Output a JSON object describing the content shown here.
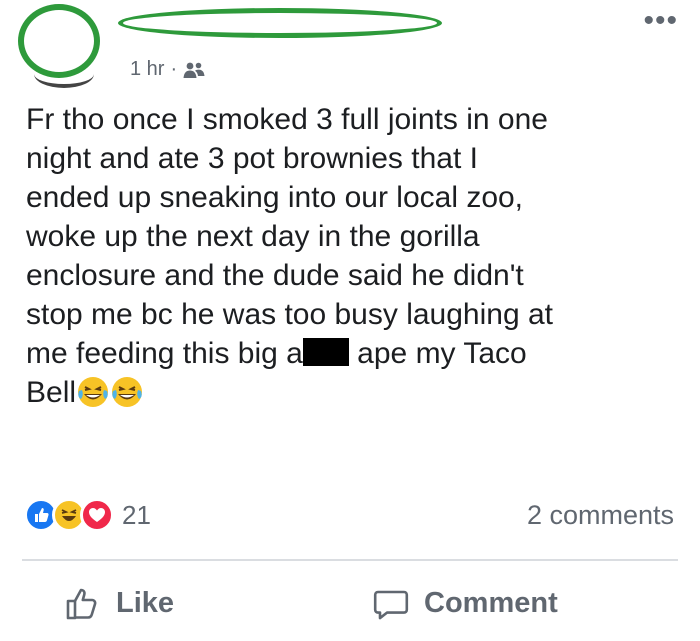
{
  "header": {
    "timestamp": "1 hr",
    "separator": "·",
    "audience_icon": "friends-icon",
    "more_icon": "more-icon"
  },
  "post": {
    "text_before_redaction": "Fr tho once I smoked 3 full joints in one\nnight and ate 3 pot brownies that I\nended up sneaking into our local zoo,\nwoke up the next day in the gorilla\nenclosure and the dude said he didn't\nstop me bc he was too busy laughing at\nme feeding this big a",
    "text_after_redaction": " ape my Taco\nBell",
    "emojis": [
      "face-with-tears-of-joy",
      "face-with-tears-of-joy"
    ]
  },
  "reactions": {
    "icons": [
      "like",
      "haha",
      "love"
    ],
    "count": "21",
    "comments_label": "2 comments"
  },
  "actions": {
    "like_label": "Like",
    "comment_label": "Comment"
  },
  "colors": {
    "redaction_green": "#2e9a3b",
    "secondary_text": "#606770",
    "primary_text": "#1c1e21",
    "like_blue": "#1877f2",
    "haha_yellow": "#f7c326",
    "love_red": "#f0284a"
  }
}
